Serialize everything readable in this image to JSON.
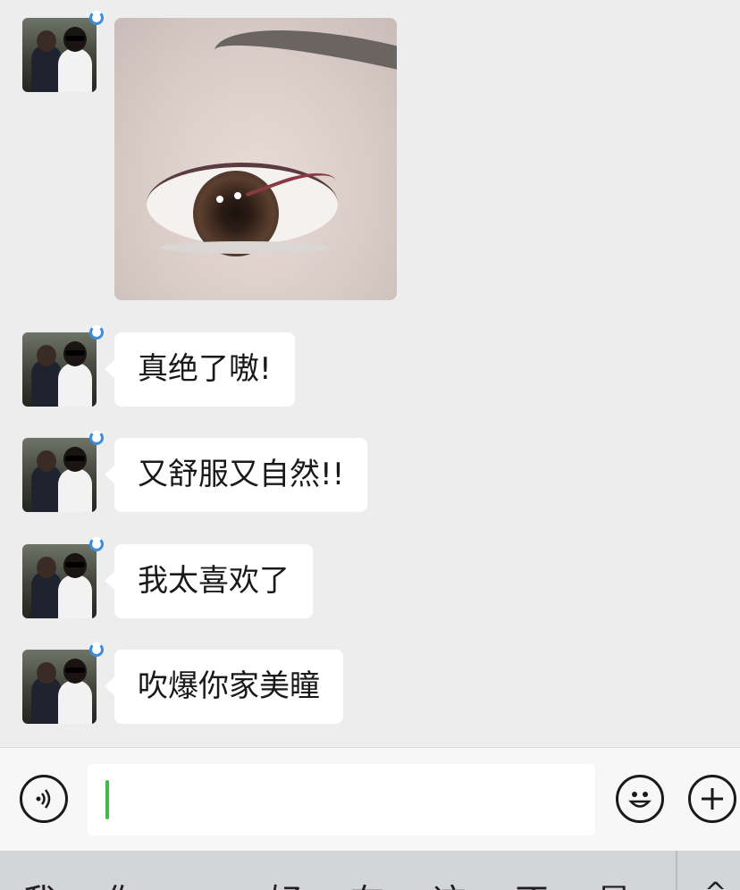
{
  "messages": [
    {
      "type": "image",
      "description_icon": "eye-photo"
    },
    {
      "type": "text",
      "text": "真绝了嗷!"
    },
    {
      "type": "text",
      "text": "又舒服又自然!!"
    },
    {
      "type": "text",
      "text": "我太喜欢了"
    },
    {
      "type": "text",
      "text": "吹爆你家美瞳"
    }
  ],
  "input_bar": {
    "voice_icon": "voice-icon",
    "emoji_icon": "emoji-icon",
    "plus_icon": "plus-icon",
    "input_value": ""
  },
  "keyboard": {
    "candidates": [
      "我",
      "你",
      "好",
      "在",
      "这",
      "不",
      "是"
    ],
    "toggle_icon": "chevron-up-icon"
  },
  "colors": {
    "background": "#ededed",
    "bubble": "#ffffff",
    "caret": "#3fba4d",
    "status_ring": "#3c8de0"
  }
}
